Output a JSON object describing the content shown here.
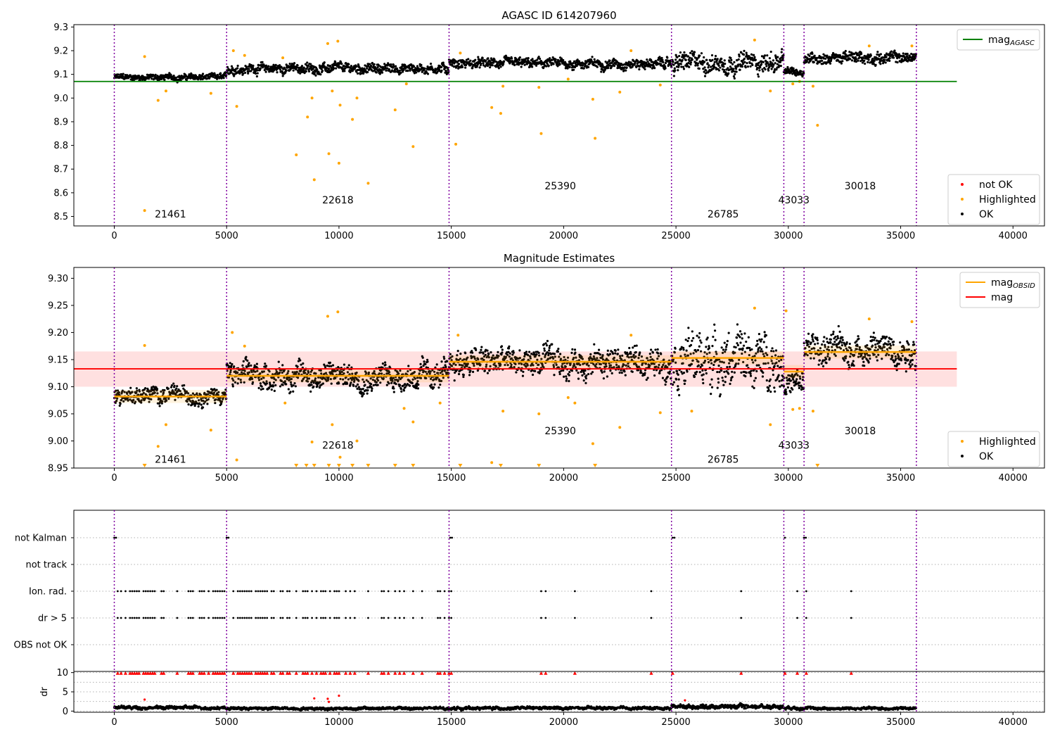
{
  "chart_data": [
    {
      "type": "scatter",
      "title": "AGASC ID 614207960",
      "xlim": [
        -1800,
        41400
      ],
      "ylim": [
        8.46,
        9.31
      ],
      "yticks": [
        8.5,
        8.6,
        8.7,
        8.8,
        8.9,
        9.0,
        9.1,
        9.2,
        9.3
      ],
      "ytick_labels": [
        "8.5",
        "8.6",
        "8.7",
        "8.8",
        "8.9",
        "9.0",
        "9.1",
        "9.2",
        "9.3"
      ],
      "xticks": [
        0,
        5000,
        10000,
        15000,
        20000,
        25000,
        30000,
        35000,
        40000
      ],
      "xtick_labels": [
        "0",
        "5000",
        "10000",
        "15000",
        "20000",
        "25000",
        "30000",
        "35000",
        "40000"
      ],
      "hlines": [
        {
          "name": "mag_AGASC",
          "y": 9.07,
          "xmin": -1800,
          "xmax": 37500,
          "color": "#008000"
        }
      ],
      "obs_boundaries": [
        0,
        5000,
        14900,
        24800,
        29800,
        30700,
        35700
      ],
      "obs_labels": [
        {
          "text": "21461",
          "x": 2500,
          "y": 8.495
        },
        {
          "text": "22618",
          "x": 9950,
          "y": 8.555
        },
        {
          "text": "25390",
          "x": 19850,
          "y": 8.615
        },
        {
          "text": "26785",
          "x": 27100,
          "y": 8.495
        },
        {
          "text": "43033",
          "x": 30250,
          "y": 8.555
        },
        {
          "text": "30018",
          "x": 33200,
          "y": 8.615
        }
      ],
      "band_series": {
        "name": "OK",
        "color": "#000000",
        "segments": [
          {
            "x0": 0,
            "x1": 5000,
            "lo": 9.065,
            "hi": 9.11
          },
          {
            "x0": 5000,
            "x1": 14900,
            "lo": 9.09,
            "hi": 9.16
          },
          {
            "x0": 14900,
            "x1": 24800,
            "lo": 9.11,
            "hi": 9.18
          },
          {
            "x0": 24800,
            "x1": 29800,
            "lo": 9.08,
            "hi": 9.22
          },
          {
            "x0": 29800,
            "x1": 30700,
            "lo": 9.08,
            "hi": 9.14
          },
          {
            "x0": 30700,
            "x1": 35700,
            "lo": 9.13,
            "hi": 9.21
          }
        ]
      },
      "highlighted_points": [
        [
          1350,
          9.175
        ],
        [
          1350,
          8.525
        ],
        [
          1950,
          8.99
        ],
        [
          2300,
          9.03
        ],
        [
          4300,
          9.02
        ],
        [
          5300,
          9.2
        ],
        [
          5450,
          8.965
        ],
        [
          5800,
          9.18
        ],
        [
          7500,
          9.17
        ],
        [
          8100,
          8.76
        ],
        [
          8600,
          8.92
        ],
        [
          8800,
          9.0
        ],
        [
          8900,
          8.655
        ],
        [
          9500,
          9.23
        ],
        [
          9550,
          8.765
        ],
        [
          9700,
          9.03
        ],
        [
          9950,
          9.24
        ],
        [
          10000,
          8.725
        ],
        [
          10050,
          8.97
        ],
        [
          10600,
          8.91
        ],
        [
          10800,
          9.0
        ],
        [
          11300,
          8.64
        ],
        [
          12500,
          8.95
        ],
        [
          13000,
          9.06
        ],
        [
          13300,
          8.795
        ],
        [
          15200,
          8.805
        ],
        [
          15400,
          9.19
        ],
        [
          16800,
          8.96
        ],
        [
          17200,
          8.935
        ],
        [
          17300,
          9.05
        ],
        [
          18900,
          9.045
        ],
        [
          19000,
          8.85
        ],
        [
          20200,
          9.08
        ],
        [
          21300,
          8.995
        ],
        [
          21400,
          8.83
        ],
        [
          22500,
          9.025
        ],
        [
          23000,
          9.2
        ],
        [
          24300,
          9.055
        ],
        [
          28500,
          9.245
        ],
        [
          29200,
          9.03
        ],
        [
          30200,
          9.06
        ],
        [
          30500,
          9.07
        ],
        [
          31100,
          9.05
        ],
        [
          31300,
          8.885
        ],
        [
          33600,
          9.22
        ],
        [
          35500,
          9.22
        ]
      ],
      "legend": {
        "placement": "upper-right",
        "entries": [
          {
            "label": "mag",
            "sub": "AGASC",
            "kind": "line",
            "color": "#008000"
          }
        ]
      },
      "legend2": {
        "placement": "lower-right",
        "entries": [
          {
            "label": "not OK",
            "kind": "dot",
            "color": "#ff0000"
          },
          {
            "label": "Highlighted",
            "kind": "dot",
            "color": "#ffa500"
          },
          {
            "label": "OK",
            "kind": "dot",
            "color": "#000000"
          }
        ]
      }
    },
    {
      "type": "scatter",
      "title": "Magnitude Estimates",
      "xlim": [
        -1800,
        41400
      ],
      "ylim": [
        8.95,
        9.32
      ],
      "yticks": [
        8.95,
        9.0,
        9.05,
        9.1,
        9.15,
        9.2,
        9.25,
        9.3
      ],
      "ytick_labels": [
        "8.95",
        "9.00",
        "9.05",
        "9.10",
        "9.15",
        "9.20",
        "9.25",
        "9.30"
      ],
      "xticks": [
        0,
        5000,
        10000,
        15000,
        20000,
        25000,
        30000,
        35000,
        40000
      ],
      "xtick_labels": [
        "0",
        "5000",
        "10000",
        "15000",
        "20000",
        "25000",
        "30000",
        "35000",
        "40000"
      ],
      "mag": {
        "name": "mag",
        "y": 9.133,
        "band": [
          9.1,
          9.165
        ],
        "xmin": -1800,
        "xmax": 37500,
        "color": "#ff0000"
      },
      "mag_obsid": [
        {
          "x0": 0,
          "x1": 5000,
          "y": 9.082
        },
        {
          "x0": 5000,
          "x1": 14900,
          "y": 9.12
        },
        {
          "x0": 14900,
          "x1": 24800,
          "y": 9.146
        },
        {
          "x0": 24800,
          "x1": 29800,
          "y": 9.153
        },
        {
          "x0": 29800,
          "x1": 30700,
          "y": 9.128
        },
        {
          "x0": 30700,
          "x1": 35700,
          "y": 9.164
        }
      ],
      "obs_boundaries": [
        0,
        5000,
        14900,
        24800,
        29800,
        30700,
        35700
      ],
      "obs_labels": [
        {
          "text": "21461",
          "x": 2500,
          "y": 8.96
        },
        {
          "text": "22618",
          "x": 9950,
          "y": 8.986
        },
        {
          "text": "25390",
          "x": 19850,
          "y": 9.012
        },
        {
          "text": "26785",
          "x": 27100,
          "y": 8.96
        },
        {
          "text": "43033",
          "x": 30250,
          "y": 8.986
        },
        {
          "text": "30018",
          "x": 33200,
          "y": 9.012
        }
      ],
      "band_series": {
        "name": "OK",
        "color": "#000000",
        "segments": [
          {
            "x0": 0,
            "x1": 5000,
            "lo": 9.06,
            "hi": 9.11
          },
          {
            "x0": 5000,
            "x1": 14900,
            "lo": 9.08,
            "hi": 9.16
          },
          {
            "x0": 14900,
            "x1": 24800,
            "lo": 9.1,
            "hi": 9.19
          },
          {
            "x0": 24800,
            "x1": 29800,
            "lo": 9.07,
            "hi": 9.23
          },
          {
            "x0": 29800,
            "x1": 30700,
            "lo": 9.07,
            "hi": 9.14
          },
          {
            "x0": 30700,
            "x1": 35700,
            "lo": 9.12,
            "hi": 9.22
          }
        ]
      },
      "highlighted_points": [
        [
          1350,
          9.176
        ],
        [
          2300,
          9.03
        ],
        [
          1950,
          8.99
        ],
        [
          4300,
          9.02
        ],
        [
          5250,
          9.2
        ],
        [
          5450,
          8.965
        ],
        [
          5800,
          9.175
        ],
        [
          7600,
          9.07
        ],
        [
          8800,
          8.998
        ],
        [
          9500,
          9.23
        ],
        [
          9700,
          9.03
        ],
        [
          9950,
          9.238
        ],
        [
          10050,
          8.97
        ],
        [
          10800,
          9.0
        ],
        [
          12900,
          9.06
        ],
        [
          13300,
          9.035
        ],
        [
          14500,
          9.07
        ],
        [
          15300,
          9.195
        ],
        [
          16800,
          8.96
        ],
        [
          17300,
          9.055
        ],
        [
          18900,
          9.05
        ],
        [
          20200,
          9.08
        ],
        [
          20500,
          9.07
        ],
        [
          21300,
          8.995
        ],
        [
          22500,
          9.025
        ],
        [
          23000,
          9.195
        ],
        [
          24300,
          9.052
        ],
        [
          25700,
          9.055
        ],
        [
          28500,
          9.245
        ],
        [
          29200,
          9.03
        ],
        [
          29900,
          9.24
        ],
        [
          30200,
          9.058
        ],
        [
          30500,
          9.06
        ],
        [
          31100,
          9.055
        ],
        [
          33600,
          9.225
        ],
        [
          35500,
          9.22
        ]
      ],
      "off_scale_markers": [
        1350,
        8100,
        8550,
        8900,
        9550,
        10000,
        10600,
        11300,
        12500,
        13300,
        15400,
        17200,
        18900,
        21400,
        31300
      ],
      "legend": {
        "placement": "upper-right",
        "entries": [
          {
            "label": "mag",
            "sub": "OBSID",
            "kind": "line",
            "color": "#ffa500"
          },
          {
            "label": "mag",
            "kind": "line",
            "color": "#ff0000"
          }
        ]
      },
      "legend2": {
        "placement": "lower-right",
        "entries": [
          {
            "label": "Highlighted",
            "kind": "dot",
            "color": "#ffa500"
          },
          {
            "label": "OK",
            "kind": "dot",
            "color": "#000000"
          }
        ]
      }
    },
    {
      "type": "scatter",
      "title": "",
      "xlim": [
        -1800,
        41400
      ],
      "categories": [
        "not Kalman",
        "not track",
        "Ion. rad.",
        "dr > 5",
        "OBS not OK"
      ],
      "flag_x": {
        "not Kalman": [
          0,
          80,
          5000,
          5080,
          14950,
          15030,
          24850,
          24930,
          29850,
          30700,
          30780
        ],
        "not track": [],
        "Ion. rad.": [
          150,
          300,
          500,
          700,
          800,
          900,
          1000,
          1100,
          1300,
          1400,
          1500,
          1600,
          1700,
          1800,
          2100,
          2200,
          2800,
          3300,
          3400,
          3500,
          3800,
          3900,
          4000,
          4200,
          4400,
          4500,
          4600,
          4700,
          4800,
          4900,
          5300,
          5500,
          5600,
          5700,
          5800,
          5900,
          6000,
          6100,
          6300,
          6400,
          6500,
          6600,
          6700,
          6800,
          7000,
          7100,
          7400,
          7500,
          7700,
          7800,
          8100,
          8400,
          8500,
          8600,
          8800,
          9000,
          9200,
          9300,
          9400,
          9600,
          9800,
          9900,
          10000,
          10300,
          10500,
          10700,
          11300,
          11900,
          12000,
          12200,
          12500,
          12700,
          12900,
          13300,
          13700,
          14400,
          14500,
          14700,
          14900,
          15000,
          19000,
          19200,
          20500,
          23900,
          27900,
          30400,
          30800,
          32800
        ],
        "dr > 5": [
          150,
          300,
          500,
          700,
          800,
          900,
          1000,
          1100,
          1300,
          1400,
          1500,
          1600,
          1700,
          1800,
          2100,
          2200,
          2800,
          3300,
          3400,
          3500,
          3800,
          3900,
          4000,
          4200,
          4400,
          4500,
          4600,
          4700,
          4800,
          4900,
          5300,
          5500,
          5600,
          5700,
          5800,
          5900,
          6000,
          6100,
          6300,
          6400,
          6500,
          6600,
          6700,
          6800,
          7000,
          7100,
          7400,
          7500,
          7700,
          7800,
          8100,
          8400,
          8500,
          8600,
          8800,
          9000,
          9200,
          9300,
          9400,
          9600,
          9800,
          9900,
          10000,
          10300,
          10500,
          10700,
          11300,
          11900,
          12000,
          12200,
          12500,
          12700,
          12900,
          13300,
          13700,
          14400,
          14500,
          14700,
          14900,
          15000,
          19000,
          19200,
          20500,
          23900,
          27900,
          30400,
          30800,
          32800
        ],
        "OBS not OK": []
      }
    },
    {
      "type": "scatter",
      "ylabel": "dr",
      "xlim": [
        -1800,
        41400
      ],
      "ylim": [
        -0.3,
        10.3
      ],
      "yticks": [
        0,
        5,
        10
      ],
      "ytick_labels": [
        "0",
        "5",
        "10"
      ],
      "minor_grid": [
        2.5,
        7.5
      ],
      "xticks": [
        0,
        5000,
        10000,
        15000,
        20000,
        25000,
        30000,
        35000,
        40000
      ],
      "xtick_labels": [
        "0",
        "5000",
        "10000",
        "15000",
        "20000",
        "25000",
        "30000",
        "35000",
        "40000"
      ],
      "band_series": {
        "name": "dr",
        "color": "#000000",
        "segments": [
          {
            "x0": 0,
            "x1": 5000,
            "lo": 0.2,
            "hi": 1.6
          },
          {
            "x0": 5000,
            "x1": 14900,
            "lo": 0.1,
            "hi": 1.3
          },
          {
            "x0": 14900,
            "x1": 24800,
            "lo": 0.1,
            "hi": 1.4
          },
          {
            "x0": 24800,
            "x1": 29800,
            "lo": 0.3,
            "hi": 2.1
          },
          {
            "x0": 29800,
            "x1": 30700,
            "lo": 0.2,
            "hi": 1.6
          },
          {
            "x0": 30700,
            "x1": 35700,
            "lo": 0.1,
            "hi": 1.3
          }
        ]
      },
      "clipped_x": [
        150,
        300,
        500,
        700,
        800,
        900,
        1000,
        1100,
        1300,
        1400,
        1500,
        1600,
        1700,
        1800,
        2100,
        2200,
        2800,
        3300,
        3400,
        3500,
        3800,
        3900,
        4000,
        4200,
        4400,
        4500,
        4600,
        4700,
        4800,
        4900,
        5300,
        5500,
        5600,
        5700,
        5800,
        5900,
        6000,
        6100,
        6300,
        6400,
        6500,
        6600,
        6700,
        6800,
        7000,
        7100,
        7400,
        7500,
        7700,
        7800,
        8100,
        8400,
        8500,
        8600,
        8800,
        9000,
        9200,
        9300,
        9400,
        9600,
        9800,
        9900,
        10000,
        10300,
        10500,
        10700,
        11300,
        11900,
        12000,
        12200,
        12500,
        12700,
        12900,
        13300,
        13700,
        14400,
        14500,
        14700,
        14900,
        15000,
        19000,
        19200,
        20500,
        23900,
        24850,
        27900,
        29850,
        30400,
        30800,
        32800
      ],
      "red_points": [
        [
          1350,
          3.0
        ],
        [
          8900,
          3.3
        ],
        [
          9500,
          3.2
        ],
        [
          10000,
          4.0
        ],
        [
          9550,
          2.4
        ],
        [
          25400,
          2.8
        ]
      ],
      "obs_boundaries": [
        0,
        5000,
        14900,
        24800,
        29800,
        30700,
        35700
      ]
    }
  ]
}
